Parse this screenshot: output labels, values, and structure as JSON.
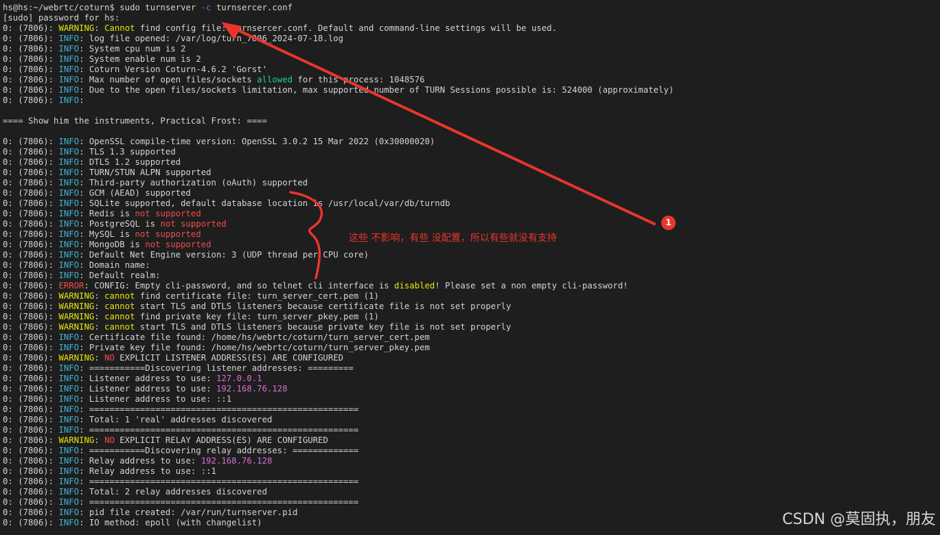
{
  "colors": {
    "default": "#d4d4d4",
    "info": "#3fb4d6",
    "warning": "#e5e510",
    "error": "#f14c4c",
    "not": "#f14c4c",
    "allowed": "#23d18b",
    "ip": "#d670d6",
    "opt": "#3b8eea",
    "annotation": "#e8362c"
  },
  "terminal": {
    "lines": [
      [
        [
          "hs@hs:~/webrtc/coturn$ sudo turnserver ",
          "default"
        ],
        [
          "-c",
          "opt"
        ],
        [
          " turnsercer.conf",
          "default"
        ]
      ],
      [
        [
          "[sudo] password for hs:",
          "default"
        ]
      ],
      [
        [
          "0: (7806): ",
          "default"
        ],
        [
          "WARNING",
          "warning"
        ],
        [
          ": ",
          "default"
        ],
        [
          "Cannot",
          "warning"
        ],
        [
          " find config file: turnsercer.conf. Default and command-line settings will be used.",
          "default"
        ]
      ],
      [
        [
          "0: (7806): ",
          "default"
        ],
        [
          "INFO",
          "info"
        ],
        [
          ": log file opened: /var/log/turn_7806_2024-07-18.log",
          "default"
        ]
      ],
      [
        [
          "0: (7806): ",
          "default"
        ],
        [
          "INFO",
          "info"
        ],
        [
          ": System cpu num is 2",
          "default"
        ]
      ],
      [
        [
          "0: (7806): ",
          "default"
        ],
        [
          "INFO",
          "info"
        ],
        [
          ": System enable num is 2",
          "default"
        ]
      ],
      [
        [
          "0: (7806): ",
          "default"
        ],
        [
          "INFO",
          "info"
        ],
        [
          ": Coturn Version Coturn-4.6.2 'Gorst'",
          "default"
        ]
      ],
      [
        [
          "0: (7806): ",
          "default"
        ],
        [
          "INFO",
          "info"
        ],
        [
          ": Max number of open files/sockets ",
          "default"
        ],
        [
          "allowed",
          "allowed"
        ],
        [
          " for this process: 1048576",
          "default"
        ]
      ],
      [
        [
          "0: (7806): ",
          "default"
        ],
        [
          "INFO",
          "info"
        ],
        [
          ": Due to the open files/sockets limitation, max supported number of TURN Sessions possible is: 524000 (approximately)",
          "default"
        ]
      ],
      [
        [
          "0: (7806): ",
          "default"
        ],
        [
          "INFO",
          "info"
        ],
        [
          ":",
          "default"
        ]
      ],
      [
        [
          "",
          "default"
        ]
      ],
      [
        [
          "==== Show him the instruments, Practical Frost: ====",
          "default"
        ]
      ],
      [
        [
          "",
          "default"
        ]
      ],
      [
        [
          "0: (7806): ",
          "default"
        ],
        [
          "INFO",
          "info"
        ],
        [
          ": OpenSSL compile-time version: OpenSSL 3.0.2 15 Mar 2022 (0x30000020)",
          "default"
        ]
      ],
      [
        [
          "0: (7806): ",
          "default"
        ],
        [
          "INFO",
          "info"
        ],
        [
          ": TLS 1.3 supported",
          "default"
        ]
      ],
      [
        [
          "0: (7806): ",
          "default"
        ],
        [
          "INFO",
          "info"
        ],
        [
          ": DTLS 1.2 supported",
          "default"
        ]
      ],
      [
        [
          "0: (7806): ",
          "default"
        ],
        [
          "INFO",
          "info"
        ],
        [
          ": TURN/STUN ALPN supported",
          "default"
        ]
      ],
      [
        [
          "0: (7806): ",
          "default"
        ],
        [
          "INFO",
          "info"
        ],
        [
          ": Third-party authorization (oAuth) supported",
          "default"
        ]
      ],
      [
        [
          "0: (7806): ",
          "default"
        ],
        [
          "INFO",
          "info"
        ],
        [
          ": GCM (AEAD) supported",
          "default"
        ]
      ],
      [
        [
          "0: (7806): ",
          "default"
        ],
        [
          "INFO",
          "info"
        ],
        [
          ": SQLite supported, default database location is /usr/local/var/db/turndb",
          "default"
        ]
      ],
      [
        [
          "0: (7806): ",
          "default"
        ],
        [
          "INFO",
          "info"
        ],
        [
          ": Redis is ",
          "default"
        ],
        [
          "not supported",
          "not"
        ]
      ],
      [
        [
          "0: (7806): ",
          "default"
        ],
        [
          "INFO",
          "info"
        ],
        [
          ": PostgreSQL is ",
          "default"
        ],
        [
          "not supported",
          "not"
        ]
      ],
      [
        [
          "0: (7806): ",
          "default"
        ],
        [
          "INFO",
          "info"
        ],
        [
          ": MySQL is ",
          "default"
        ],
        [
          "not supported",
          "not"
        ]
      ],
      [
        [
          "0: (7806): ",
          "default"
        ],
        [
          "INFO",
          "info"
        ],
        [
          ": MongoDB is ",
          "default"
        ],
        [
          "not supported",
          "not"
        ]
      ],
      [
        [
          "0: (7806): ",
          "default"
        ],
        [
          "INFO",
          "info"
        ],
        [
          ": Default Net Engine version: 3 (UDP thread per CPU core)",
          "default"
        ]
      ],
      [
        [
          "0: (7806): ",
          "default"
        ],
        [
          "INFO",
          "info"
        ],
        [
          ": Domain name:",
          "default"
        ]
      ],
      [
        [
          "0: (7806): ",
          "default"
        ],
        [
          "INFO",
          "info"
        ],
        [
          ": Default realm:",
          "default"
        ]
      ],
      [
        [
          "0: (7806): ",
          "default"
        ],
        [
          "ERROR",
          "error"
        ],
        [
          ": CONFIG: Empty cli-password, and so telnet cli interface is ",
          "default"
        ],
        [
          "disabled",
          "warning"
        ],
        [
          "! Please set a non empty cli-password!",
          "default"
        ]
      ],
      [
        [
          "0: (7806): ",
          "default"
        ],
        [
          "WARNING",
          "warning"
        ],
        [
          ": ",
          "default"
        ],
        [
          "cannot",
          "warning"
        ],
        [
          " find certificate file: turn_server_cert.pem (1)",
          "default"
        ]
      ],
      [
        [
          "0: (7806): ",
          "default"
        ],
        [
          "WARNING",
          "warning"
        ],
        [
          ": ",
          "default"
        ],
        [
          "cannot",
          "warning"
        ],
        [
          " start TLS and DTLS listeners because certificate file is not set properly",
          "default"
        ]
      ],
      [
        [
          "0: (7806): ",
          "default"
        ],
        [
          "WARNING",
          "warning"
        ],
        [
          ": ",
          "default"
        ],
        [
          "cannot",
          "warning"
        ],
        [
          " find private key file: turn_server_pkey.pem (1)",
          "default"
        ]
      ],
      [
        [
          "0: (7806): ",
          "default"
        ],
        [
          "WARNING",
          "warning"
        ],
        [
          ": ",
          "default"
        ],
        [
          "cannot",
          "warning"
        ],
        [
          " start TLS and DTLS listeners because private key file is not set properly",
          "default"
        ]
      ],
      [
        [
          "0: (7806): ",
          "default"
        ],
        [
          "INFO",
          "info"
        ],
        [
          ": Certificate file found: /home/hs/webrtc/coturn/turn_server_cert.pem",
          "default"
        ]
      ],
      [
        [
          "0: (7806): ",
          "default"
        ],
        [
          "INFO",
          "info"
        ],
        [
          ": Private key file found: /home/hs/webrtc/coturn/turn_server_pkey.pem",
          "default"
        ]
      ],
      [
        [
          "0: (7806): ",
          "default"
        ],
        [
          "WARNING",
          "warning"
        ],
        [
          ": ",
          "default"
        ],
        [
          "NO",
          "not"
        ],
        [
          " EXPLICIT LISTENER ADDRESS(ES) ARE CONFIGURED",
          "default"
        ]
      ],
      [
        [
          "0: (7806): ",
          "default"
        ],
        [
          "INFO",
          "info"
        ],
        [
          ": ===========Discovering listener addresses: =========",
          "default"
        ]
      ],
      [
        [
          "0: (7806): ",
          "default"
        ],
        [
          "INFO",
          "info"
        ],
        [
          ": Listener address to use: ",
          "default"
        ],
        [
          "127.0.0.1",
          "ip"
        ]
      ],
      [
        [
          "0: (7806): ",
          "default"
        ],
        [
          "INFO",
          "info"
        ],
        [
          ": Listener address to use: ",
          "default"
        ],
        [
          "192.168.76.128",
          "ip"
        ]
      ],
      [
        [
          "0: (7806): ",
          "default"
        ],
        [
          "INFO",
          "info"
        ],
        [
          ": Listener address to use: ::1",
          "default"
        ]
      ],
      [
        [
          "0: (7806): ",
          "default"
        ],
        [
          "INFO",
          "info"
        ],
        [
          ": =====================================================",
          "default"
        ]
      ],
      [
        [
          "0: (7806): ",
          "default"
        ],
        [
          "INFO",
          "info"
        ],
        [
          ": Total: 1 'real' addresses discovered",
          "default"
        ]
      ],
      [
        [
          "0: (7806): ",
          "default"
        ],
        [
          "INFO",
          "info"
        ],
        [
          ": =====================================================",
          "default"
        ]
      ],
      [
        [
          "0: (7806): ",
          "default"
        ],
        [
          "WARNING",
          "warning"
        ],
        [
          ": ",
          "default"
        ],
        [
          "NO",
          "not"
        ],
        [
          " EXPLICIT RELAY ADDRESS(ES) ARE CONFIGURED",
          "default"
        ]
      ],
      [
        [
          "0: (7806): ",
          "default"
        ],
        [
          "INFO",
          "info"
        ],
        [
          ": ===========Discovering relay addresses: =============",
          "default"
        ]
      ],
      [
        [
          "0: (7806): ",
          "default"
        ],
        [
          "INFO",
          "info"
        ],
        [
          ": Relay address to use: ",
          "default"
        ],
        [
          "192.168.76.128",
          "ip"
        ]
      ],
      [
        [
          "0: (7806): ",
          "default"
        ],
        [
          "INFO",
          "info"
        ],
        [
          ": Relay address to use: ::1",
          "default"
        ]
      ],
      [
        [
          "0: (7806): ",
          "default"
        ],
        [
          "INFO",
          "info"
        ],
        [
          ": =====================================================",
          "default"
        ]
      ],
      [
        [
          "0: (7806): ",
          "default"
        ],
        [
          "INFO",
          "info"
        ],
        [
          ": Total: 2 relay addresses discovered",
          "default"
        ]
      ],
      [
        [
          "0: (7806): ",
          "default"
        ],
        [
          "INFO",
          "info"
        ],
        [
          ": =====================================================",
          "default"
        ]
      ],
      [
        [
          "0: (7806): ",
          "default"
        ],
        [
          "INFO",
          "info"
        ],
        [
          ": pid file created: /var/run/turnserver.pid",
          "default"
        ]
      ],
      [
        [
          "0: (7806): ",
          "default"
        ],
        [
          "INFO",
          "info"
        ],
        [
          ": IO method: epoll (with changelist)",
          "default"
        ]
      ]
    ]
  },
  "annotation": {
    "note": "这些 不影响，有些 没配置，所以有些就没有支持",
    "badge": "1"
  },
  "watermark": "CSDN @莫固执，朋友"
}
